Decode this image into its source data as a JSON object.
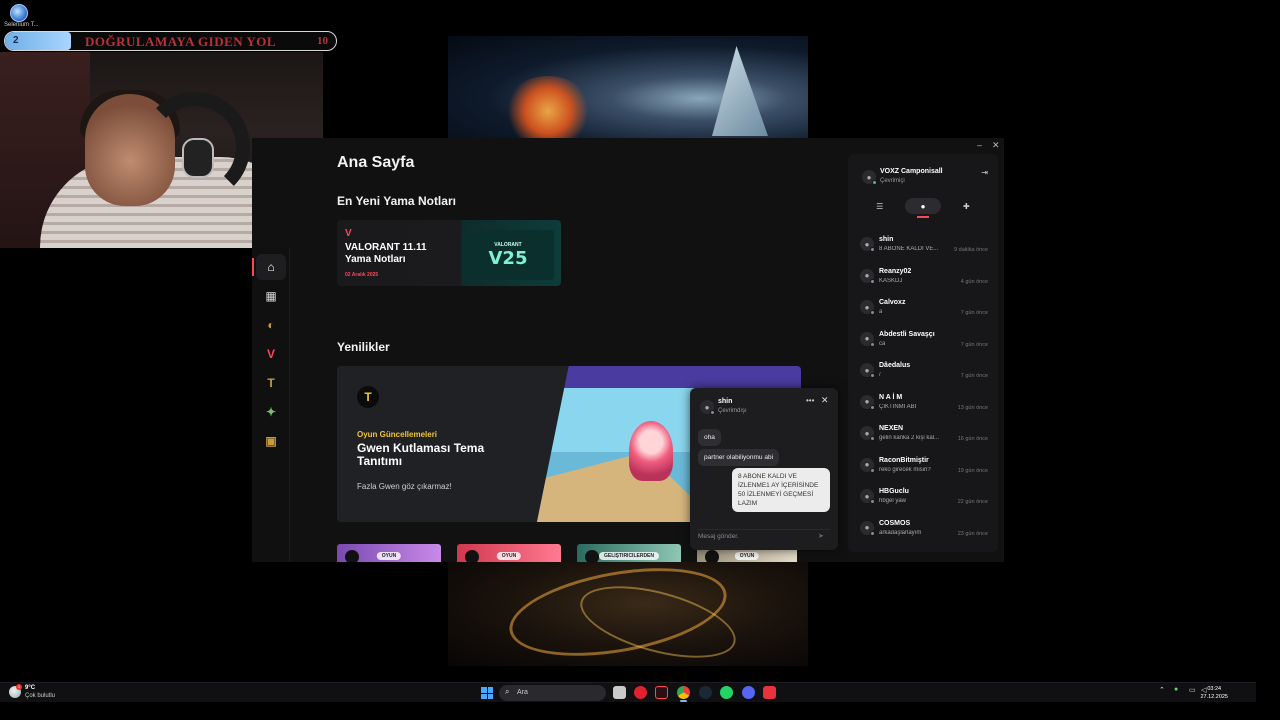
{
  "overlay": {
    "desktop_icon_label": "Selenium T...",
    "progress": {
      "current": "2",
      "title": "DOĞRULAMAYA GIDEN YOL",
      "goal": "10",
      "fill_fraction": 0.2
    }
  },
  "launcher": {
    "page_title": "Ana Sayfa",
    "patch_section_title": "En Yeni Yama Notları",
    "patch_card": {
      "title": "VALORANT 11.11 Yama Notları",
      "date": "02 Aralık 2025",
      "badge_label": "VALORANT",
      "badge_value": "V25"
    },
    "news_section_title": "Yenilikler",
    "feature": {
      "category": "Oyun Güncellemeleri",
      "title": "Gwen Kutlaması Tema Tanıtımı",
      "subtitle": "Fazla Gwen göz çıkarmaz!"
    },
    "thumbs": [
      {
        "tag": "OYUN",
        "color": "#b07ad8"
      },
      {
        "tag": "OYUN",
        "color": "#e04a6a"
      },
      {
        "tag": "GELIŞTIRICILERDEN",
        "color": "#3a8a7a"
      },
      {
        "tag": "OYUN",
        "color": "#c9c0a8"
      }
    ],
    "rail_icons": [
      "home-icon",
      "grid-icon",
      "league-icon",
      "valorant-icon",
      "tft-icon",
      "wildrift-icon",
      "runeterra-icon"
    ],
    "window_controls": {
      "minimize": "–",
      "close": "✕"
    }
  },
  "friends": {
    "me": {
      "name": "VOXZ Camponisall",
      "status": "Çevrimiçi"
    },
    "list": [
      {
        "name": "shin",
        "message": "8 ABONE KALDI VE...",
        "time": "9 dakika önce",
        "online": false
      },
      {
        "name": "Reanzy02",
        "message": "KASKDJ",
        "time": "4 gün önce",
        "online": false
      },
      {
        "name": "Calvoxz",
        "message": "a",
        "time": "7 gün önce",
        "online": false
      },
      {
        "name": "Abdestli Savaşçı",
        "message": "ca",
        "time": "7 gün önce",
        "online": false
      },
      {
        "name": "Dâedalus",
        "message": "/",
        "time": "7 gün önce",
        "online": false
      },
      {
        "name": "N A İ M",
        "message": "ÇIKTINMI ABİ",
        "time": "13 gün önce",
        "online": false
      },
      {
        "name": "NEXEN",
        "message": "gelin kanka 2 kişi kal...",
        "time": "16 gün önce",
        "online": false
      },
      {
        "name": "RaconBitmiştir",
        "message": "reko girecek misin?",
        "time": "19 gün önce",
        "online": false
      },
      {
        "name": "HBGuclu",
        "message": "hbgel yaw",
        "time": "22 gün önce",
        "online": false
      },
      {
        "name": "COSMOS",
        "message": "arkadaşlarlayım",
        "time": "23 gün önce",
        "online": false
      }
    ]
  },
  "chat": {
    "name": "shin",
    "status": "Çevrimdışı",
    "messages": [
      {
        "text": "oha",
        "dir": "in"
      },
      {
        "text": "partner olabiliyonmu abi",
        "dir": "in"
      },
      {
        "text": "8 ABONE KALDI VE İZLENME1 AY İÇERİSİNDE 50 İZLENMEYİ GEÇMESİ LAZIM",
        "dir": "out"
      }
    ],
    "input_placeholder": "Mesaj gönder."
  },
  "taskbar": {
    "weather_temp": "9°C",
    "weather_desc": "Çok bulutlu",
    "search_placeholder": "Ara",
    "time": "03:24",
    "date": "27.12.2025",
    "apps": [
      "file-explorer-icon",
      "opera-icon",
      "valorant-app-icon",
      "chrome-icon",
      "steam-icon",
      "whatsapp-icon",
      "discord-icon",
      "riot-client-icon"
    ]
  }
}
